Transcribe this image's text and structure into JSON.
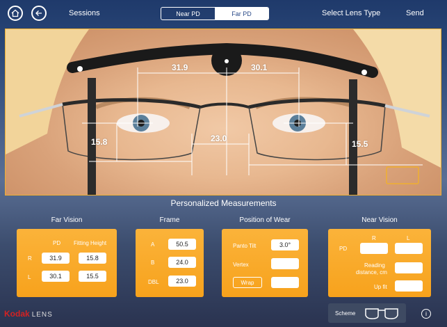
{
  "topbar": {
    "sessions": "Sessions",
    "tab_near": "Near PD",
    "tab_far": "Far PD",
    "select_lens": "Select Lens Type",
    "send": "Send"
  },
  "measurements": {
    "left_pd": "31.9",
    "right_pd": "30.1",
    "dbl": "23.0",
    "left_height": "15.8",
    "right_height": "15.5"
  },
  "section_title": "Personalized Measurements",
  "far_vision": {
    "title": "Far Vision",
    "col_pd": "PD",
    "col_fh": "Fitting Height",
    "row_r": "R",
    "row_l": "L",
    "r_pd": "31.9",
    "r_fh": "15.8",
    "l_pd": "30.1",
    "l_fh": "15.5"
  },
  "frame": {
    "title": "Frame",
    "a_label": "A",
    "b_label": "B",
    "dbl_label": "DBL",
    "a": "50.5",
    "b": "24.0",
    "dbl": "23.0"
  },
  "position_of_wear": {
    "title": "Position of Wear",
    "panto_label": "Panto Tilt",
    "panto": "3.0°",
    "vertex_label": "Vertex",
    "vertex": "",
    "wrap_label": "Wrap",
    "wrap": ""
  },
  "near_vision": {
    "title": "Near Vision",
    "col_r": "R",
    "col_l": "L",
    "pd_label": "PD",
    "reading_label_1": "Reading",
    "reading_label_2": "distance, cm",
    "upfit_label": "Up fit"
  },
  "bottom": {
    "brand": "Kodak",
    "brand_suffix": "LENS",
    "scheme": "Scheme",
    "info": "i"
  },
  "colors": {
    "panel": "#f7a21c",
    "frame_border": "#f0b030",
    "brand_red": "#d32222"
  }
}
